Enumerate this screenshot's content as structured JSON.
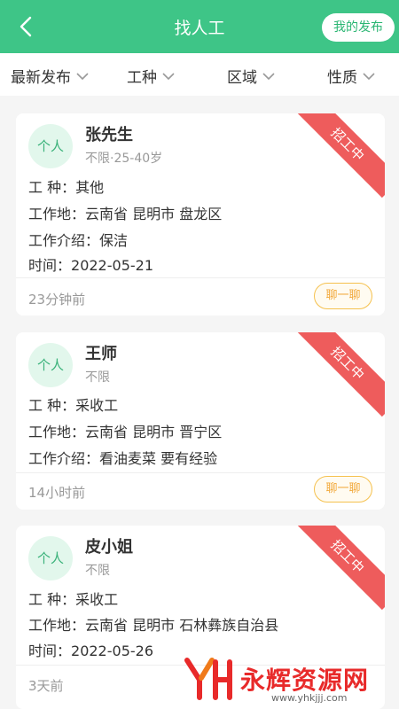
{
  "header": {
    "title": "找人工",
    "publish_label": "我的发布"
  },
  "filters": [
    {
      "label": "最新发布"
    },
    {
      "label": "工种"
    },
    {
      "label": "区域"
    },
    {
      "label": "性质"
    }
  ],
  "cards": [
    {
      "avatar": "个人",
      "name": "张先生",
      "age": "不限·25-40岁",
      "badge": "招工中",
      "rows": [
        {
          "label": "工  种：",
          "value": "其他"
        },
        {
          "label": "工作地：",
          "value": "云南省 昆明市 盘龙区"
        },
        {
          "label": "工作介绍：",
          "value": "保洁"
        },
        {
          "label": "时间：",
          "value": "2022-05-21"
        }
      ],
      "posted": "23分钟前",
      "chat_label": "聊一聊"
    },
    {
      "avatar": "个人",
      "name": "王师",
      "age": "不限",
      "badge": "招工中",
      "rows": [
        {
          "label": "工  种：",
          "value": "采收工"
        },
        {
          "label": "工作地：",
          "value": "云南省 昆明市 晋宁区"
        },
        {
          "label": "工作介绍：",
          "value": "看油麦菜 要有经验"
        }
      ],
      "posted": "14小时前",
      "chat_label": "聊一聊"
    },
    {
      "avatar": "个人",
      "name": "皮小姐",
      "age": "不限",
      "badge": "招工中",
      "rows": [
        {
          "label": "工  种：",
          "value": "采收工"
        },
        {
          "label": "工作地：",
          "value": "云南省 昆明市 石林彝族自治县"
        },
        {
          "label": "时间：",
          "value": "2022-05-26"
        }
      ],
      "posted": "3天前",
      "chat_label": "聊一聊"
    }
  ],
  "watermark": {
    "logo_text": "YH",
    "text": "永辉资源网",
    "url": "www.yhkjjj.com"
  },
  "colors": {
    "brand_green": "#3ec587",
    "badge_red": "#ee5c5c",
    "chat_orange": "#f2a93b"
  }
}
